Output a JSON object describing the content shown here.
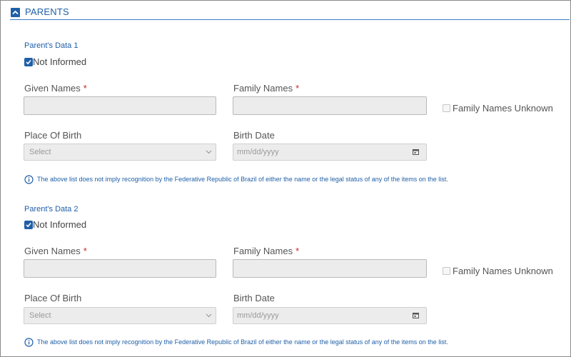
{
  "section": {
    "title": "PARENTS"
  },
  "parents": [
    {
      "title": "Parent's Data 1",
      "not_informed_label": "Not Informed",
      "given_names_label": "Given Names",
      "family_names_label": "Family Names",
      "required_marker": "*",
      "family_names_unknown_label": "Family Names Unknown",
      "place_of_birth_label": "Place Of Birth",
      "place_of_birth_value": "Select",
      "birth_date_label": "Birth Date",
      "birth_date_placeholder": "mm/dd/yyyy",
      "notice": "The above list does not imply recognition by the Federative Republic of Brazil of either the name or the legal status of any of the items on the list."
    },
    {
      "title": "Parent's Data 2",
      "not_informed_label": "Not Informed",
      "given_names_label": "Given Names",
      "family_names_label": "Family Names",
      "required_marker": "*",
      "family_names_unknown_label": "Family Names Unknown",
      "place_of_birth_label": "Place Of Birth",
      "place_of_birth_value": "Select",
      "birth_date_label": "Birth Date",
      "birth_date_placeholder": "mm/dd/yyyy",
      "notice": "The above list does not imply recognition by the Federative Republic of Brazil of either the name or the legal status of any of the items on the list."
    }
  ],
  "colors": {
    "accent": "#1f5fa8",
    "required": "#c62828",
    "input_bg": "#ececec"
  },
  "icons": {
    "collapse": "chevron-up-icon",
    "checkbox": "checkmark-icon",
    "select": "chevron-down-icon",
    "date": "calendar-icon",
    "info": "info-icon"
  }
}
